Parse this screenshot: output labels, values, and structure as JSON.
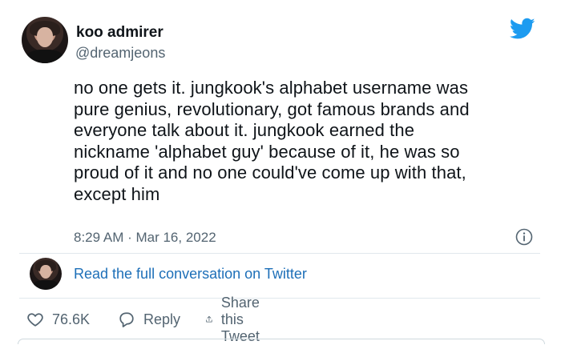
{
  "user": {
    "display_name": "koo admirer",
    "handle": "@dreamjeons"
  },
  "tweet": {
    "lines": [
      "no one gets it. jungkook's alphabet username was",
      "pure genius, revolutionary, got famous brands and",
      "everyone talk about it. jungkook earned the",
      "nickname 'alphabet guy' because of it, he was so",
      "proud of it and no one could've come up with that,",
      "except him"
    ],
    "timestamp": "8:29 AM · Mar 16, 2022"
  },
  "conversation": {
    "link_text": "Read the full conversation on Twitter"
  },
  "actions": {
    "likes": "76.6K",
    "reply_label": "Reply",
    "share_label": "Share this Tweet"
  },
  "icons": {
    "brand": "twitter-bird-icon",
    "info": "info-icon",
    "like": "heart-icon",
    "reply": "reply-icon",
    "share": "share-icon"
  },
  "colors": {
    "brand_blue": "#1d9bf0",
    "link_blue": "#1d6fb8",
    "secondary_text": "#536471",
    "primary_text": "#0f1419"
  }
}
